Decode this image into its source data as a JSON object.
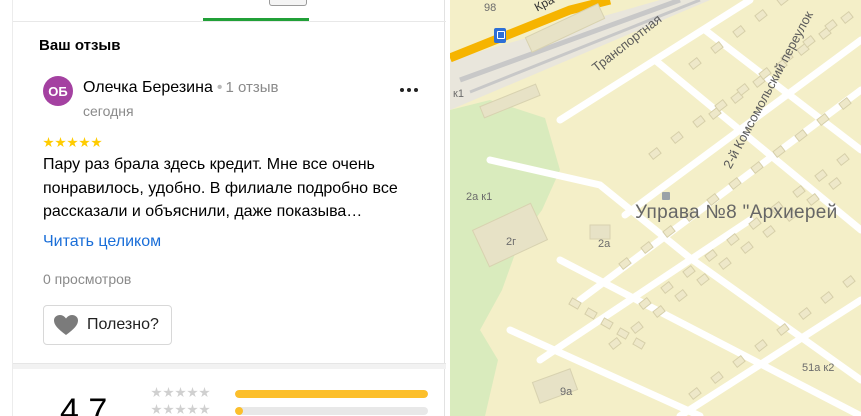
{
  "review_section": {
    "title": "Ваш отзыв"
  },
  "review": {
    "avatar_initials": "ОБ",
    "author": "Олечка Березина",
    "separator": "•",
    "review_count": "1 отзыв",
    "date": "сегодня",
    "rating": 5,
    "text": "Пару раз брала здесь кредит. Мне все очень понравилось, удобно. В филиале подробно все рассказали и объяснили, даже показыва…",
    "read_more": "Читать целиком",
    "views": "0 просмотров",
    "useful_label": "Полезно?"
  },
  "rating_summary": {
    "average": "4.7",
    "distribution": [
      {
        "stars": 5,
        "fill": 1.0
      },
      {
        "stars": 4,
        "fill": 0.04
      }
    ]
  },
  "map": {
    "district_label": "Управа №8 \"Архиерей",
    "streets": [
      "Транспортная",
      "2-й Комсомольский переулок",
      "Кра"
    ],
    "buildings": [
      "98",
      "к1",
      "2а к1",
      "2г",
      "2а",
      "51а к2",
      "9а"
    ]
  },
  "colors": {
    "accent_green": "#21a038",
    "avatar_bg": "#a441a1",
    "star_gold": "#fcbf2b",
    "link_blue": "#1a6ed8",
    "map_base": "#f4efc8",
    "road_yellow": "#f6b400"
  },
  "icons": {
    "more": "more-dots-icon",
    "useful": "heart-icon",
    "metro": "metro-station-icon"
  }
}
